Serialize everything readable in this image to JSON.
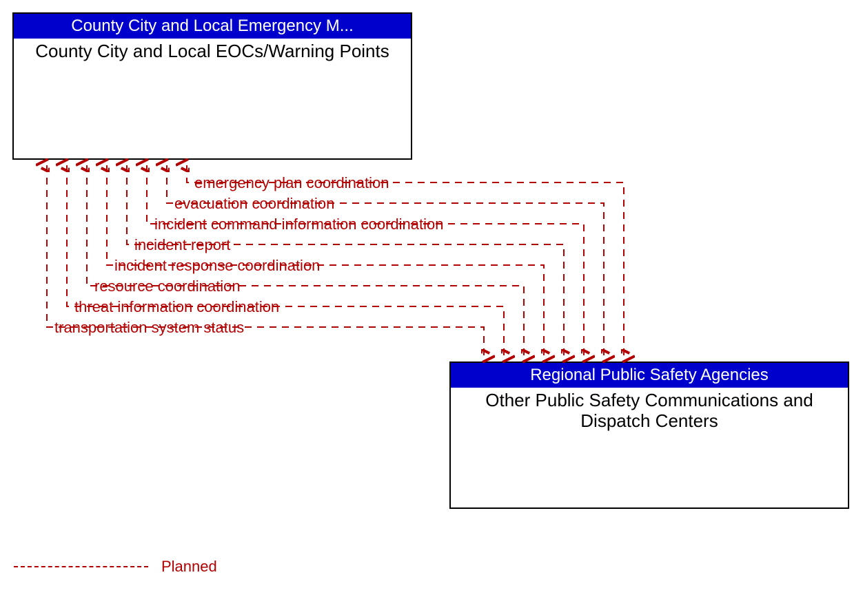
{
  "box_a": {
    "header": "County City and Local Emergency M...",
    "body": "County City and Local EOCs/Warning Points"
  },
  "box_b": {
    "header": "Regional Public Safety Agencies",
    "body": "Other Public Safety Communications and Dispatch Centers"
  },
  "flows": [
    "emergency plan coordination",
    "evacuation coordination",
    "incident command information coordination",
    "incident report",
    "incident response coordination",
    "resource coordination",
    "threat information coordination",
    "transportation system status"
  ],
  "legend": {
    "label": "Planned"
  },
  "colors": {
    "flow": "#b30000",
    "header_bg": "#0000cc"
  }
}
